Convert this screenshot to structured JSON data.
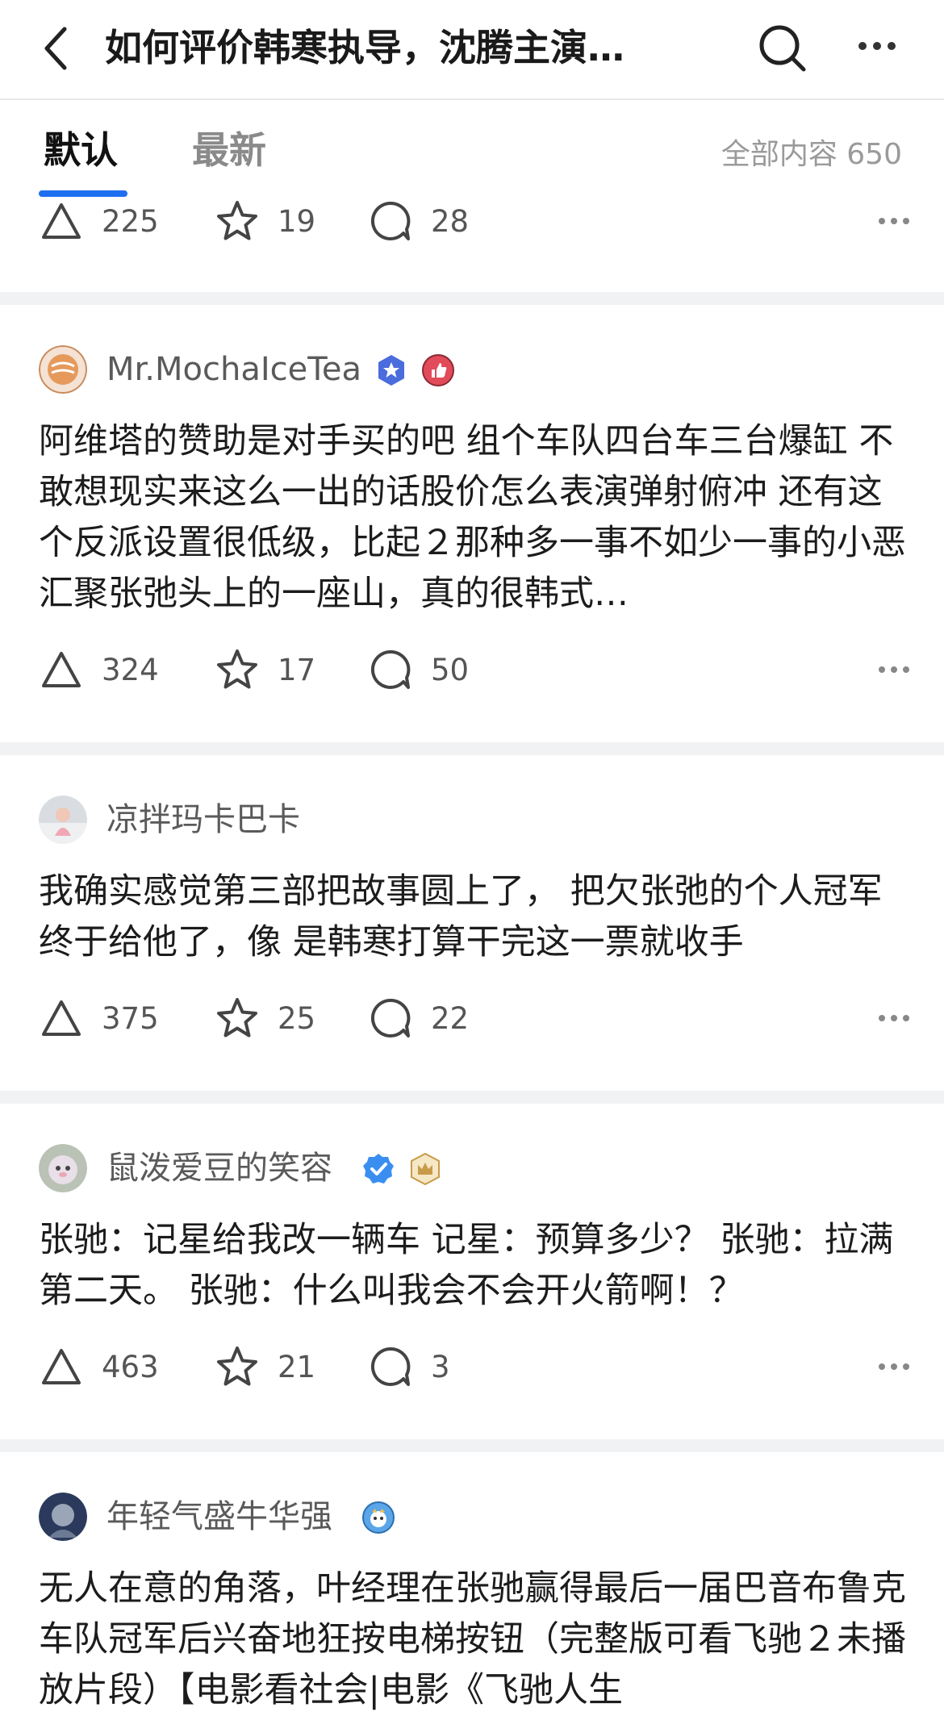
{
  "header": {
    "title": "如何评价韩寒执导，沈腾主演…",
    "back_icon": "chevron-left-icon",
    "search_icon": "search-icon",
    "more_icon": "more-horizontal-icon"
  },
  "tabs": {
    "items": [
      {
        "label": "默认",
        "active": true
      },
      {
        "label": "最新",
        "active": false
      }
    ],
    "count_label": "全部内容 650",
    "accent": "#1e6ff0"
  },
  "posts": [
    {
      "username": "",
      "content": "",
      "likes": "225",
      "stars": "19",
      "comments": "28"
    },
    {
      "username": "Mr.MochaIceTea",
      "content": "阿维塔的赞助是对手买的吧 组个车队四台车三台爆缸 不敢想现实来这么一出的话股价怎么表演弹射俯冲 还有这个反派设置很低级，比起２那种多一事不如少一事的小恶汇聚张弛头上的一座山，真的很韩式…",
      "likes": "324",
      "stars": "17",
      "comments": "50"
    },
    {
      "username": "凉拌玛卡巴卡",
      "content": "我确实感觉第三部把故事圆上了， 把欠张弛的个人冠军终于给他了，像 是韩寒打算干完这一票就收手",
      "likes": "375",
      "stars": "25",
      "comments": "22"
    },
    {
      "username": "鼠泼爱豆的笑容",
      "content": "张驰：记星给我改一辆车 记星：预算多少？ 张驰：拉满 第二天。 张驰：什么叫我会不会开火箭啊！？",
      "likes": "463",
      "stars": "21",
      "comments": "3"
    },
    {
      "username": "年轻气盛牛华强",
      "content": "无人在意的角落，叶经理在张驰赢得最后一届巴音布鲁克车队冠军后兴奋地狂按电梯按钮（完整版可看飞驰２未播放片段）【电影看社会|电影《飞驰人生",
      "likes": "",
      "stars": "",
      "comments": ""
    }
  ]
}
